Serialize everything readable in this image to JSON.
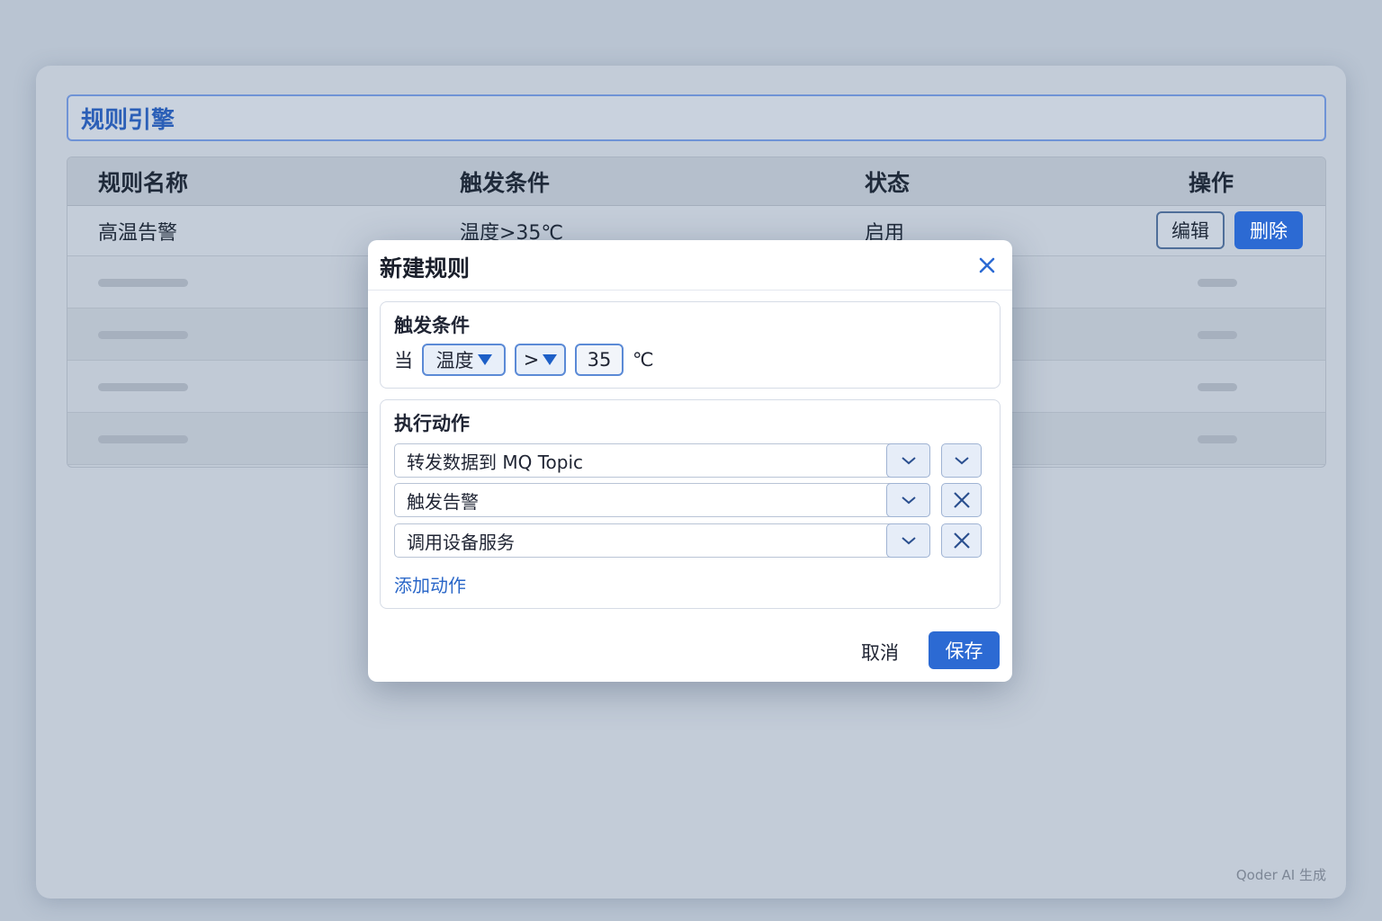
{
  "app": {
    "title": "规则引擎",
    "watermark": "Qoder AI 生成"
  },
  "table": {
    "headers": [
      "规则名称",
      "触发条件",
      "状态",
      "操作"
    ],
    "rows": [
      {
        "name": "高温告警",
        "condition": "温度>35℃",
        "status": "启用"
      }
    ],
    "edit_label": "编辑",
    "delete_label": "删除"
  },
  "modal": {
    "title": "新建规则",
    "close_icon": "close-icon",
    "trigger": {
      "title": "触发条件",
      "when_label": "当",
      "field": "温度",
      "operator": ">",
      "value": "35",
      "unit": "℃"
    },
    "actions": {
      "title": "执行动作",
      "items": [
        {
          "label": "转发数据到 MQ Topic",
          "side_icon": "chevron-down-icon"
        },
        {
          "label": "触发告警",
          "side_icon": "close-icon"
        },
        {
          "label": "调用设备服务",
          "side_icon": "close-icon"
        }
      ],
      "add_label": "添加动作"
    },
    "cancel_label": "取消",
    "save_label": "保存"
  },
  "colors": {
    "accent": "#2c6ad3",
    "background": "#b9c4d2"
  }
}
